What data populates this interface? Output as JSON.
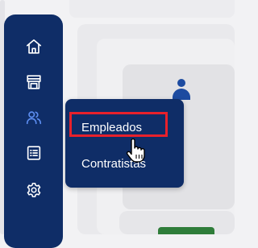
{
  "sidebar": {
    "items": [
      {
        "icon": "home-icon"
      },
      {
        "icon": "store-icon"
      },
      {
        "icon": "people-icon"
      },
      {
        "icon": "list-icon"
      },
      {
        "icon": "gear-icon"
      }
    ]
  },
  "flyout": {
    "items": [
      {
        "label": "Empleados"
      },
      {
        "label": "Contratistas"
      }
    ]
  },
  "colors": {
    "sidebar_bg": "#0f2d67",
    "icon_color": "#ffffff",
    "active_icon_color": "#5c8df0",
    "highlight": "#e8212b"
  },
  "cursor": {
    "icon": "hand-pointer-icon"
  }
}
